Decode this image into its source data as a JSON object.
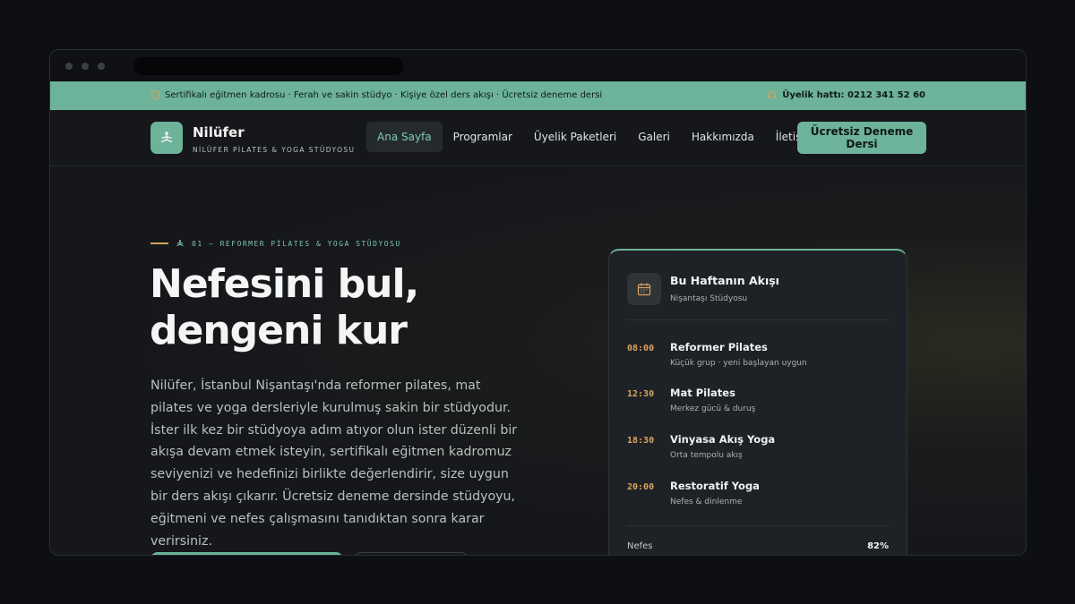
{
  "topbar": {
    "features": "Sertifikalı eğitmen kadrosu · Ferah ve sakin stüdyo · Kişiye özel ders akışı · Ücretsiz deneme dersi",
    "phone": "Üyelik hattı: 0212 341 52 60"
  },
  "brand": {
    "name": "Nilüfer",
    "subtitle": "NİLÜFER PİLATES & YOGA STÜDYOSU"
  },
  "nav": {
    "items": [
      "Ana Sayfa",
      "Programlar",
      "Üyelik Paketleri",
      "Galeri",
      "Hakkımızda",
      "İletişim"
    ],
    "active": "Ana Sayfa",
    "cta": "Ücretsiz Deneme Dersi"
  },
  "hero": {
    "eyebrow": "01 — REFORMER PİLATES & YOGA STÜDYOSU",
    "title_line1": "Nefesini bul,",
    "title_line2": "dengeni kur",
    "lead": "Nilüfer, İstanbul Nişantaşı'nda reformer pilates, mat pilates ve yoga dersleriyle kurulmuş sakin bir stüdyodur. İster ilk kez bir stüdyoya adım atıyor olun ister düzenli bir akışa devam etmek isteyin, sertifikalı eğitmen kadromuz seviyenizi ve hedefinizi birlikte değerlendirir, size uygun bir ders akışı çıkarır. Ücretsiz deneme dersinde stüdyoyu, eğitmeni ve nefes çalışmasını tanıdıktan sonra karar verirsiniz."
  },
  "schedule": {
    "title": "Bu Haftanın Akışı",
    "location": "Nişantaşı Stüdyosu",
    "classes": [
      {
        "time": "08:00",
        "name": "Reformer Pilates",
        "desc": "Küçük grup · yeni başlayan uygun"
      },
      {
        "time": "12:30",
        "name": "Mat Pilates",
        "desc": "Merkez gücü & duruş"
      },
      {
        "time": "18:30",
        "name": "Vinyasa Akış Yoga",
        "desc": "Orta tempolu akış"
      },
      {
        "time": "20:00",
        "name": "Restoratif Yoga",
        "desc": "Nefes & dinlenme"
      }
    ],
    "stat_label": "Nefes",
    "stat_value": "82%"
  },
  "colors": {
    "accent": "#6db39a",
    "time": "#d9a35f",
    "background": "#15171b"
  },
  "icons": {
    "shield": "shield-icon",
    "phone": "headset-icon",
    "logo": "meditation-icon",
    "calendar": "calendar-icon"
  }
}
